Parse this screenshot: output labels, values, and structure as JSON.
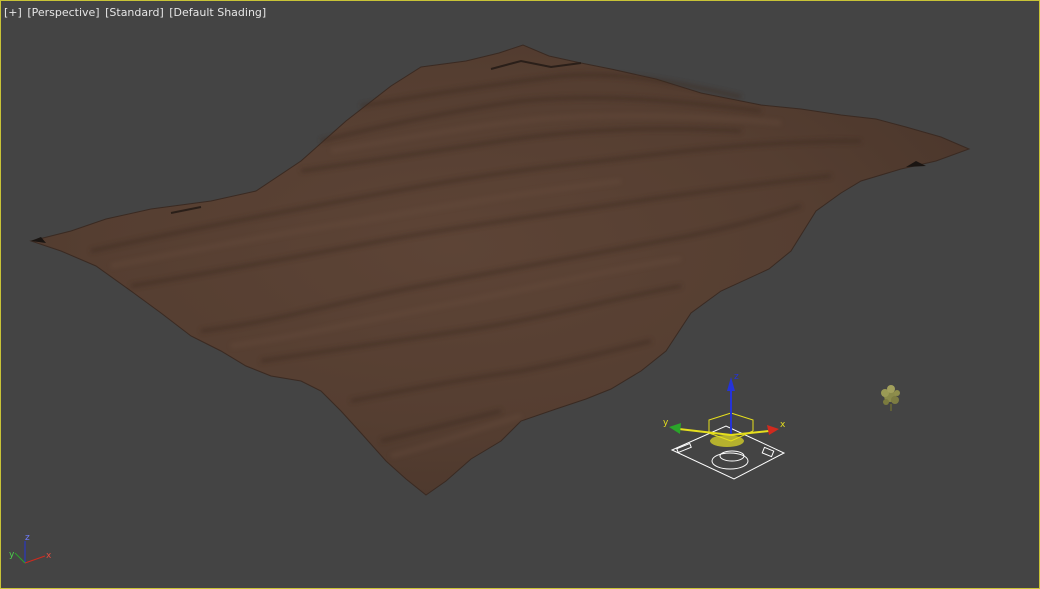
{
  "viewport": {
    "menu_label": "[+]",
    "view_label": "[Perspective]",
    "mode_label": "[Standard]",
    "shading_label": "[Default Shading]"
  },
  "gizmo": {
    "x_label": "x",
    "y_label": "y",
    "z_label": "z"
  },
  "orientation_tripod": {
    "x_label": "x",
    "y_label": "y",
    "z_label": "z"
  },
  "colors": {
    "border_active": "#c8c337",
    "background": "#444444",
    "terrain": "#5a4134",
    "axis_x": "#d12a1e",
    "axis_y": "#2aa52a",
    "axis_z": "#2533d8",
    "selection_yellow": "#e6df1d"
  }
}
